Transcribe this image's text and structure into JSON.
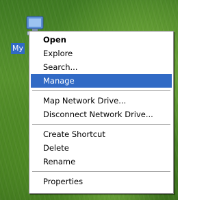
{
  "desktop": {
    "icon_label": "My",
    "icon_name": "my-computer-icon"
  },
  "context_menu": {
    "groups": [
      [
        {
          "label": "Open",
          "bold": true
        },
        {
          "label": "Explore"
        },
        {
          "label": "Search..."
        },
        {
          "label": "Manage",
          "highlighted": true
        }
      ],
      [
        {
          "label": "Map Network Drive..."
        },
        {
          "label": "Disconnect Network Drive..."
        }
      ],
      [
        {
          "label": "Create Shortcut"
        },
        {
          "label": "Delete"
        },
        {
          "label": "Rename"
        }
      ],
      [
        {
          "label": "Properties"
        }
      ]
    ]
  },
  "colors": {
    "highlight": "#316ac5",
    "menu_background": "#ffffff",
    "desktop_green": "#4f8a24"
  }
}
